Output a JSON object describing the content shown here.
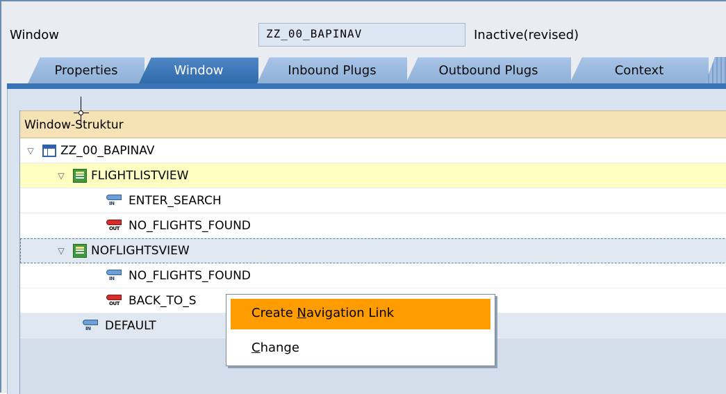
{
  "header": {
    "label": "Window",
    "field_value": "ZZ_00_BAPINAV",
    "status": "Inactive(revised)"
  },
  "tabs": [
    {
      "label": "Properties",
      "active": false
    },
    {
      "label": "Window",
      "active": true
    },
    {
      "label": "Inbound Plugs",
      "active": false
    },
    {
      "label": "Outbound Plugs",
      "active": false
    },
    {
      "label": "Context",
      "active": false
    }
  ],
  "tree": {
    "header": "Window-Struktur",
    "rows": [
      {
        "label": "ZZ_00_BAPINAV",
        "icon": "window-icon",
        "expanded": true
      },
      {
        "label": "FLIGHTLISTVIEW",
        "icon": "view-icon",
        "expanded": true,
        "selected": true
      },
      {
        "label": "ENTER_SEARCH",
        "icon": "inbound-plug-icon"
      },
      {
        "label": "NO_FLIGHTS_FOUND",
        "icon": "outbound-plug-icon"
      },
      {
        "label": "NOFLIGHTSVIEW",
        "icon": "view-icon",
        "expanded": true,
        "focused": true
      },
      {
        "label": "NO_FLIGHTS_FOUND",
        "icon": "inbound-plug-icon"
      },
      {
        "label": "BACK_TO_S",
        "icon": "outbound-plug-icon"
      },
      {
        "label": "DEFAULT",
        "icon": "inbound-plug-icon"
      }
    ]
  },
  "plug_badges": {
    "in": "IN",
    "out": "OUT"
  },
  "context_menu": {
    "items": [
      {
        "before": "Create ",
        "mnemonic": "N",
        "after": "avigation Link",
        "highlighted": true
      },
      {
        "before": "",
        "mnemonic": "C",
        "after": "hange",
        "highlighted": false
      }
    ]
  },
  "colors": {
    "active_tab": "#2f6aab",
    "menu_highlight": "#ff9c00",
    "tree_header": "#f6e3b5",
    "selected_row": "#ffffc2"
  }
}
